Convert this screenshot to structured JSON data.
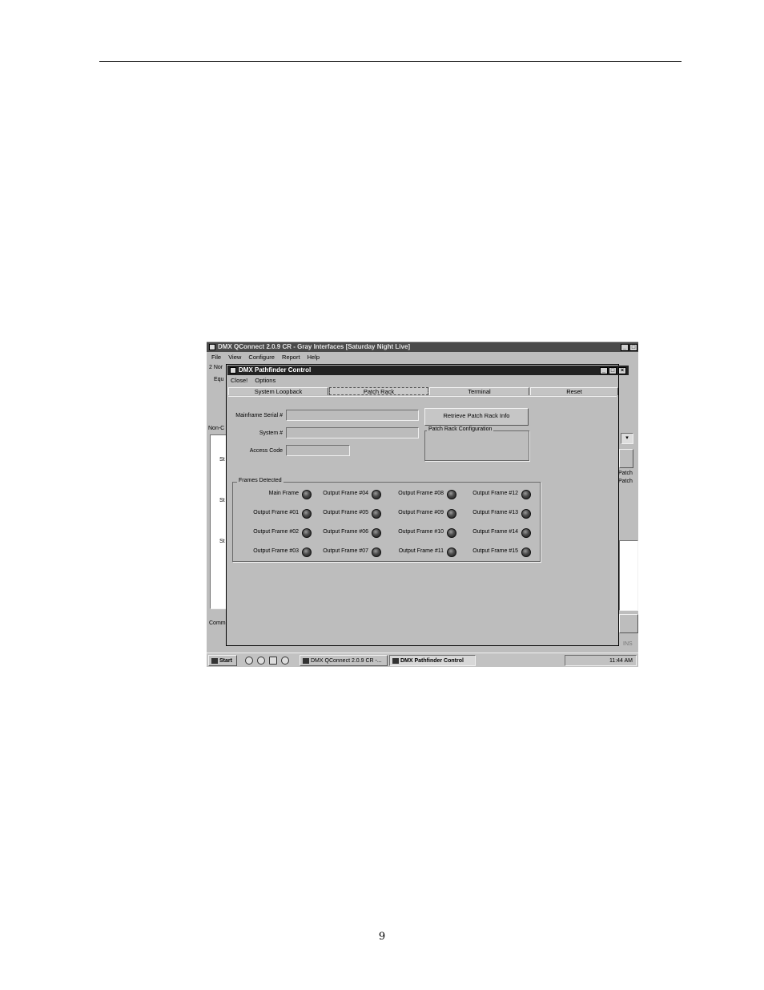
{
  "page": {
    "number": "9"
  },
  "main_window": {
    "title": "DMX QConnect 2.0.9 CR - Gray Interfaces [Saturday Night Live]",
    "menu": [
      "File",
      "View",
      "Configure",
      "Report",
      "Help"
    ],
    "fragments": {
      "nor": "2 Nor",
      "equ": "Equ",
      "non": "Non-C",
      "s1": "St",
      "s2": "St",
      "s3": "St",
      "comm": "Comm",
      "patch1": "Patch",
      "patch2": "Patch",
      "ins": "INS"
    }
  },
  "dialog": {
    "title": "DMX Pathfinder Control",
    "menu": [
      "Close!",
      "Options"
    ],
    "tabs": [
      "System Loopback",
      "Patch Rack",
      "Terminal",
      "Reset"
    ],
    "selected_tab": "Patch Rack",
    "fields": {
      "mainframe_serial_label": "Mainframe Serial #",
      "system_label": "System #",
      "access_code_label": "Access Code"
    },
    "retrieve_button": "Retrieve Patch Rack Info",
    "patch_rack_config_title": "Patch Rack Configuration",
    "frames_detected": {
      "title": "Frames Detected",
      "columns": [
        [
          "Main Frame",
          "Output Frame #01",
          "Output Frame #02",
          "Output Frame #03"
        ],
        [
          "Output Frame #04",
          "Output Frame #05",
          "Output Frame #06",
          "Output Frame #07"
        ],
        [
          "Output Frame #08",
          "Output Frame #09",
          "Output Frame #10",
          "Output Frame #11"
        ],
        [
          "Output Frame #12",
          "Output Frame #13",
          "Output Frame #14",
          "Output Frame #15"
        ]
      ]
    }
  },
  "taskbar": {
    "start": "Start",
    "tasks": [
      "DMX QConnect 2.0.9 CR -...",
      "DMX Pathfinder Control"
    ],
    "clock": "11:44 AM"
  },
  "colors": {
    "window_face": "#bdbdbd",
    "title_active": "#222222",
    "title_inactive": "#4a4a4a"
  }
}
